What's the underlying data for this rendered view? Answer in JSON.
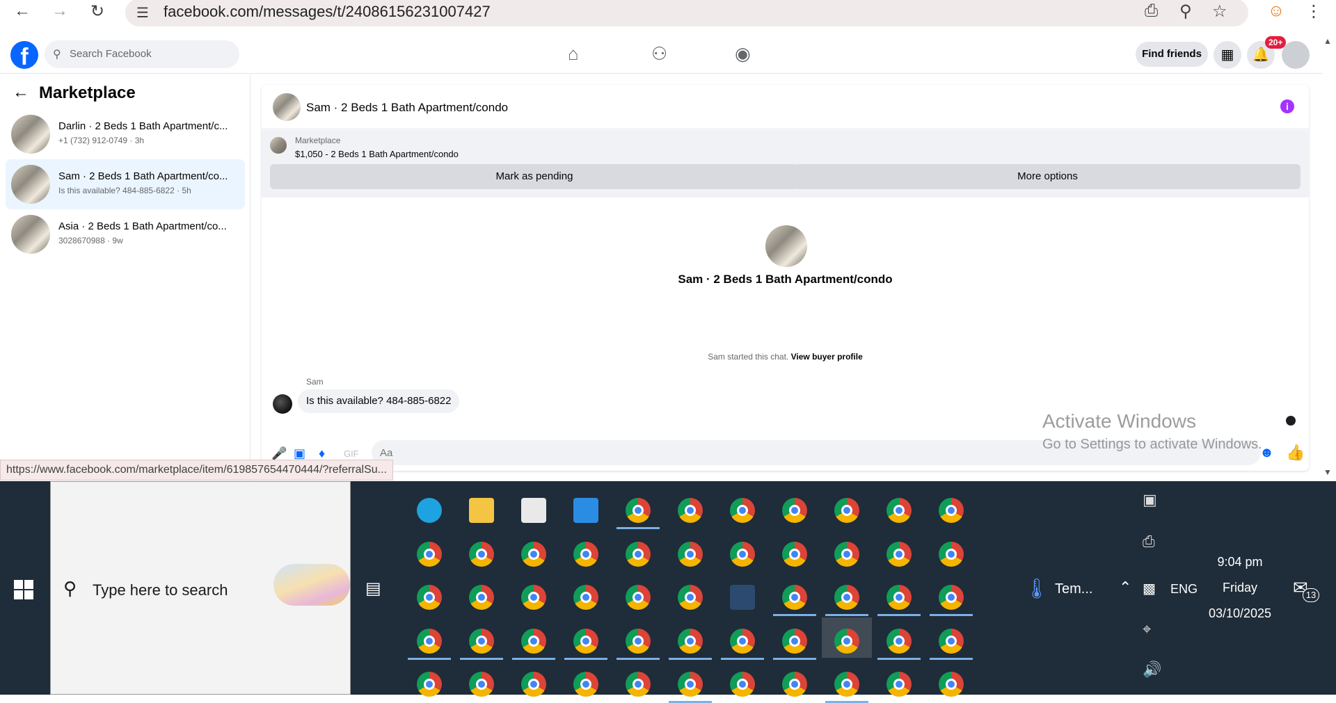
{
  "browser": {
    "url": "facebook.com/messages/t/24086156231007427",
    "back_icon": "back-arrow-icon",
    "forward_icon": "forward-arrow-icon",
    "reload_icon": "reload-icon"
  },
  "fb_header": {
    "logo": "f",
    "search_placeholder": "Search Facebook",
    "find_friends_label": "Find friends",
    "notif_badge": "20+"
  },
  "sidebar": {
    "title": "Marketplace",
    "conversations": [
      {
        "name": "Darlin · 2 Beds 1 Bath Apartment/c...",
        "sub": "+1 (732) 912-0749 · 3h"
      },
      {
        "name": "Sam · 2 Beds 1 Bath Apartment/co...",
        "sub": "Is this available? 484-885-6822 · 5h"
      },
      {
        "name": "Asia · 2 Beds 1 Bath Apartment/co...",
        "sub": "3028670988 · 9w"
      }
    ]
  },
  "chat": {
    "title": "Sam · 2 Beds 1 Bath Apartment/condo",
    "listing_label": "Marketplace",
    "listing_desc": "$1,050 - 2 Beds 1 Bath Apartment/condo",
    "mark_pending_label": "Mark as pending",
    "more_options_label": "More options",
    "center_title": "Sam · 2 Beds 1 Bath Apartment/condo",
    "started_text": "Sam started this chat.",
    "view_buyer_profile": "View buyer profile",
    "sender": "Sam",
    "message": "Is this available? 484-885-6822",
    "input_placeholder": "Aa"
  },
  "watermark": {
    "line1": "Activate Windows",
    "line2": "Go to Settings to activate Windows."
  },
  "status_url": "https://www.facebook.com/marketplace/item/619857654470444/?referralSu...",
  "taskbar": {
    "search_placeholder": "Type here to search",
    "weather": "Tem...",
    "lang": "ENG",
    "time": "9:04 pm",
    "day": "Friday",
    "date": "03/10/2025",
    "notif_count": "13"
  }
}
